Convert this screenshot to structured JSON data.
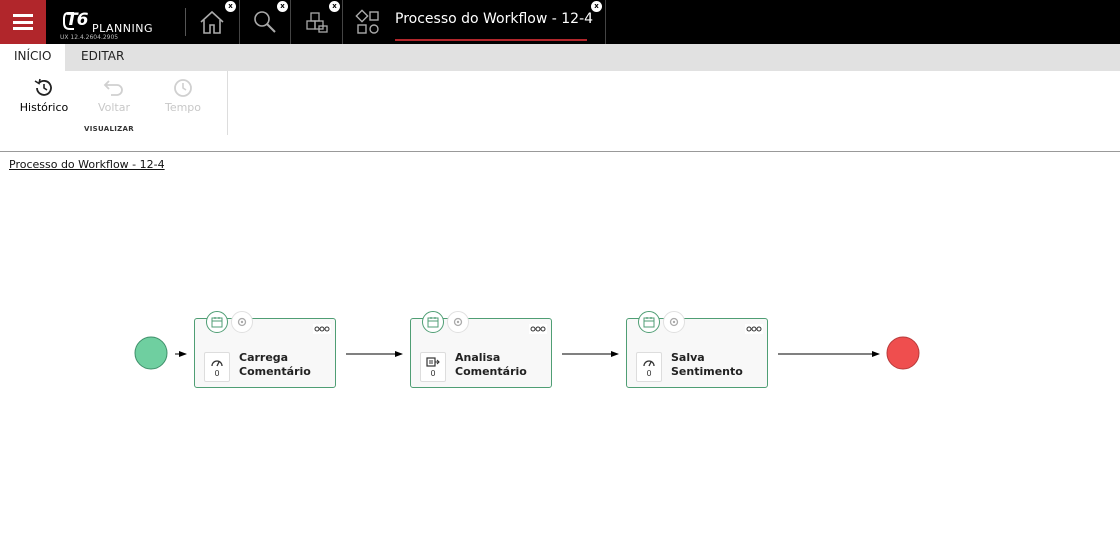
{
  "topbar": {
    "logo_text": "T6",
    "logo_sub": "PLANNING",
    "version": "UX 12.4.2604.2905",
    "close_glyph": "x",
    "buttons": [
      {
        "icon": "home-icon"
      },
      {
        "icon": "search-icon"
      },
      {
        "icon": "cubes-icon"
      },
      {
        "icon": "workflow-icon"
      }
    ],
    "active_tab_title": "Processo do Workflow - 12-4",
    "accent_color": "#b1262b"
  },
  "ribbon": {
    "tabs": [
      {
        "label": "INÍCIO",
        "active": true
      },
      {
        "label": "EDITAR",
        "active": false
      }
    ],
    "items": [
      {
        "label": "Histórico",
        "icon": "history-icon",
        "enabled": true
      },
      {
        "label": "Voltar",
        "icon": "undo-icon",
        "enabled": false
      },
      {
        "label": "Tempo",
        "icon": "clock-icon",
        "enabled": false
      }
    ],
    "group_label": "VISUALIZAR"
  },
  "breadcrumb": "Processo do Workflow - 12-4",
  "workflow": {
    "start_color": "#6fcfa0",
    "end_color": "#ef4e4e",
    "node_border_color": "#4f9e74",
    "nodes": [
      {
        "label": "Carrega\nComentário",
        "count": "0",
        "icon": "gauge-icon"
      },
      {
        "label": "Analisa\nComentário",
        "count": "0",
        "icon": "transform-icon"
      },
      {
        "label": "Salva\nSentimento",
        "count": "0",
        "icon": "gauge-icon"
      }
    ]
  }
}
